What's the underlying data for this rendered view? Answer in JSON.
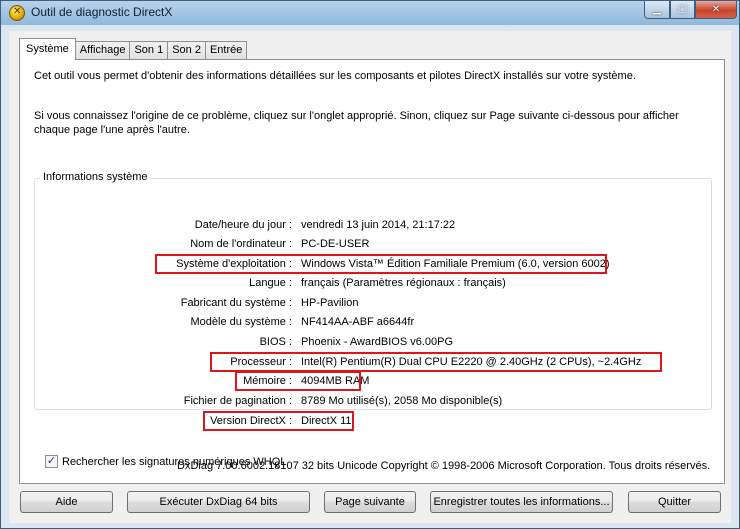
{
  "window": {
    "title": "Outil de diagnostic DirectX"
  },
  "tabs": [
    {
      "label": "Système"
    },
    {
      "label": "Affichage"
    },
    {
      "label": "Son 1"
    },
    {
      "label": "Son 2"
    },
    {
      "label": "Entrée"
    }
  ],
  "intro": {
    "line1": "Cet outil vous permet d'obtenir des informations détaillées sur les composants et pilotes DirectX installés sur votre système.",
    "line2": "Si vous connaissez l'origine de ce problème, cliquez sur l'onglet approprié. Sinon, cliquez sur Page suivante ci-dessous pour afficher chaque page l'une après l'autre."
  },
  "system_info": {
    "title": "Informations système",
    "rows": [
      {
        "label": "Date/heure du jour :",
        "value": "vendredi 13 juin 2014, 21:17:22"
      },
      {
        "label": "Nom de l'ordinateur :",
        "value": "PC-DE-USER"
      },
      {
        "label": "Système d'exploitation :",
        "value": "Windows Vista™ Édition Familiale Premium (6.0, version 6002)"
      },
      {
        "label": "Langue :",
        "value": "français (Paramètres régionaux : français)"
      },
      {
        "label": "Fabricant du système :",
        "value": "HP-Pavilion"
      },
      {
        "label": "Modèle du système :",
        "value": "NF414AA-ABF a6644fr"
      },
      {
        "label": "BIOS :",
        "value": "Phoenix - AwardBIOS v6.00PG"
      },
      {
        "label": "Processeur :",
        "value": "Intel(R) Pentium(R) Dual  CPU  E2220  @ 2.40GHz (2 CPUs), ~2.4GHz"
      },
      {
        "label": "Mémoire :",
        "value": "4094MB RAM"
      },
      {
        "label": "Fichier de pagination :",
        "value": "8789 Mo utilisé(s), 2058 Mo disponible(s)"
      },
      {
        "label": "Version DirectX :",
        "value": "DirectX 11"
      }
    ]
  },
  "whql": {
    "label": "Rechercher les signatures numériques WHQL",
    "checked": true
  },
  "footer": "DxDiag 7.00.6002.18107 32 bits Unicode Copyright © 1998-2006 Microsoft Corporation. Tous droits réservés.",
  "buttons": {
    "help": "Aide",
    "run64": "Exécuter DxDiag 64 bits",
    "next": "Page suivante",
    "save": "Enregistrer toutes les informations...",
    "quit": "Quitter"
  },
  "highlight_color": "#e0151b"
}
